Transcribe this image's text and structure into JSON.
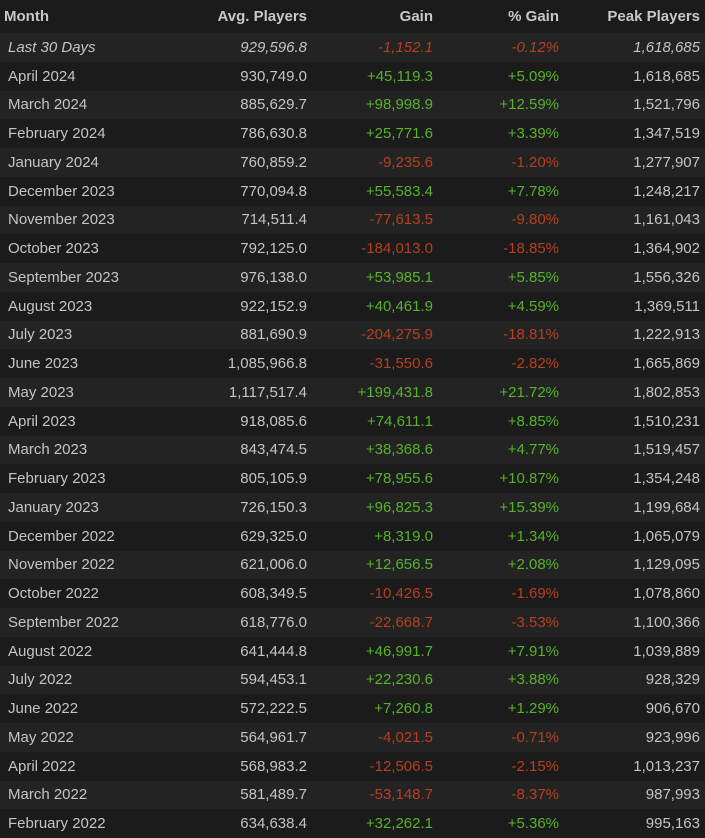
{
  "header": {
    "month": "Month",
    "avg": "Avg. Players",
    "gain": "Gain",
    "pct": "% Gain",
    "peak": "Peak Players"
  },
  "colors": {
    "positive": "#57b22a",
    "negative": "#b5401f"
  },
  "rows": [
    {
      "month": "Last 30 Days",
      "avg": "929,596.8",
      "gain": "-1,152.1",
      "pct": "-0.12%",
      "peak": "1,618,685"
    },
    {
      "month": "April 2024",
      "avg": "930,749.0",
      "gain": "+45,119.3",
      "pct": "+5.09%",
      "peak": "1,618,685"
    },
    {
      "month": "March 2024",
      "avg": "885,629.7",
      "gain": "+98,998.9",
      "pct": "+12.59%",
      "peak": "1,521,796"
    },
    {
      "month": "February 2024",
      "avg": "786,630.8",
      "gain": "+25,771.6",
      "pct": "+3.39%",
      "peak": "1,347,519"
    },
    {
      "month": "January 2024",
      "avg": "760,859.2",
      "gain": "-9,235.6",
      "pct": "-1.20%",
      "peak": "1,277,907"
    },
    {
      "month": "December 2023",
      "avg": "770,094.8",
      "gain": "+55,583.4",
      "pct": "+7.78%",
      "peak": "1,248,217"
    },
    {
      "month": "November 2023",
      "avg": "714,511.4",
      "gain": "-77,613.5",
      "pct": "-9.80%",
      "peak": "1,161,043"
    },
    {
      "month": "October 2023",
      "avg": "792,125.0",
      "gain": "-184,013.0",
      "pct": "-18.85%",
      "peak": "1,364,902"
    },
    {
      "month": "September 2023",
      "avg": "976,138.0",
      "gain": "+53,985.1",
      "pct": "+5.85%",
      "peak": "1,556,326"
    },
    {
      "month": "August 2023",
      "avg": "922,152.9",
      "gain": "+40,461.9",
      "pct": "+4.59%",
      "peak": "1,369,511"
    },
    {
      "month": "July 2023",
      "avg": "881,690.9",
      "gain": "-204,275.9",
      "pct": "-18.81%",
      "peak": "1,222,913"
    },
    {
      "month": "June 2023",
      "avg": "1,085,966.8",
      "gain": "-31,550.6",
      "pct": "-2.82%",
      "peak": "1,665,869"
    },
    {
      "month": "May 2023",
      "avg": "1,117,517.4",
      "gain": "+199,431.8",
      "pct": "+21.72%",
      "peak": "1,802,853"
    },
    {
      "month": "April 2023",
      "avg": "918,085.6",
      "gain": "+74,611.1",
      "pct": "+8.85%",
      "peak": "1,510,231"
    },
    {
      "month": "March 2023",
      "avg": "843,474.5",
      "gain": "+38,368.6",
      "pct": "+4.77%",
      "peak": "1,519,457"
    },
    {
      "month": "February 2023",
      "avg": "805,105.9",
      "gain": "+78,955.6",
      "pct": "+10.87%",
      "peak": "1,354,248"
    },
    {
      "month": "January 2023",
      "avg": "726,150.3",
      "gain": "+96,825.3",
      "pct": "+15.39%",
      "peak": "1,199,684"
    },
    {
      "month": "December 2022",
      "avg": "629,325.0",
      "gain": "+8,319.0",
      "pct": "+1.34%",
      "peak": "1,065,079"
    },
    {
      "month": "November 2022",
      "avg": "621,006.0",
      "gain": "+12,656.5",
      "pct": "+2.08%",
      "peak": "1,129,095"
    },
    {
      "month": "October 2022",
      "avg": "608,349.5",
      "gain": "-10,426.5",
      "pct": "-1.69%",
      "peak": "1,078,860"
    },
    {
      "month": "September 2022",
      "avg": "618,776.0",
      "gain": "-22,668.7",
      "pct": "-3.53%",
      "peak": "1,100,366"
    },
    {
      "month": "August 2022",
      "avg": "641,444.8",
      "gain": "+46,991.7",
      "pct": "+7.91%",
      "peak": "1,039,889"
    },
    {
      "month": "July 2022",
      "avg": "594,453.1",
      "gain": "+22,230.6",
      "pct": "+3.88%",
      "peak": "928,329"
    },
    {
      "month": "June 2022",
      "avg": "572,222.5",
      "gain": "+7,260.8",
      "pct": "+1.29%",
      "peak": "906,670"
    },
    {
      "month": "May 2022",
      "avg": "564,961.7",
      "gain": "-4,021.5",
      "pct": "-0.71%",
      "peak": "923,996"
    },
    {
      "month": "April 2022",
      "avg": "568,983.2",
      "gain": "-12,506.5",
      "pct": "-2.15%",
      "peak": "1,013,237"
    },
    {
      "month": "March 2022",
      "avg": "581,489.7",
      "gain": "-53,148.7",
      "pct": "-8.37%",
      "peak": "987,993"
    },
    {
      "month": "February 2022",
      "avg": "634,638.4",
      "gain": "+32,262.1",
      "pct": "+5.36%",
      "peak": "995,163"
    }
  ]
}
